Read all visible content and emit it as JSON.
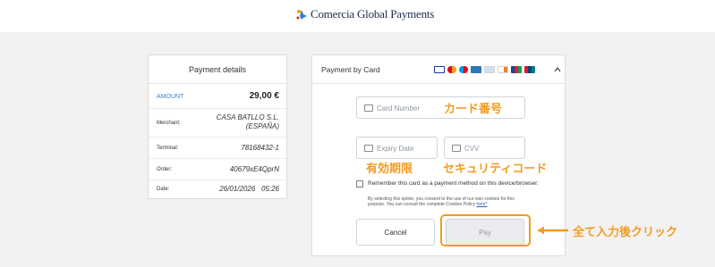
{
  "header": {
    "logo_text": "Comercia Global Payments"
  },
  "payment_details": {
    "title": "Payment details",
    "amount_label": "AMOUNT",
    "amount_value": "29,00 €",
    "rows": [
      {
        "label": "Merchant:",
        "value": "CASA BATLLO S.L. (ESPAÑA)"
      },
      {
        "label": "Terminal:",
        "value": "78168432-1"
      },
      {
        "label": "Order:",
        "value": "40679xE4QprN"
      },
      {
        "label": "Date:",
        "value": "26/01/2026   05:26"
      }
    ]
  },
  "payment_by_card": {
    "title": "Payment by Card",
    "brands": [
      "visa-icon",
      "mastercard-icon",
      "maestro-icon",
      "amex-icon",
      "diners-icon",
      "discover-icon",
      "jcb-icon",
      "unionpay-icon"
    ],
    "card_number_placeholder": "Card Number",
    "expiry_placeholder": "Expiry Date",
    "cvv_placeholder": "CVV",
    "remember_text": "Remember this card as a payment method on this device/browser.",
    "consent_text": "By selecting this option, you consent to the use of our own cookies for this purpose. You can consult the complete Cookies Policy",
    "policy_link": "here*",
    "cancel_label": "Cancel",
    "pay_label": "Pay"
  },
  "annotations": {
    "card_number": "カード番号",
    "expiry": "有効期限",
    "cvv": "セキュリティコード",
    "pay": "全て入力後クリック"
  },
  "colors": {
    "accent_orange": "#f39c1f",
    "link_blue": "#2d86d6",
    "brand_navy": "#1d2a4a"
  }
}
